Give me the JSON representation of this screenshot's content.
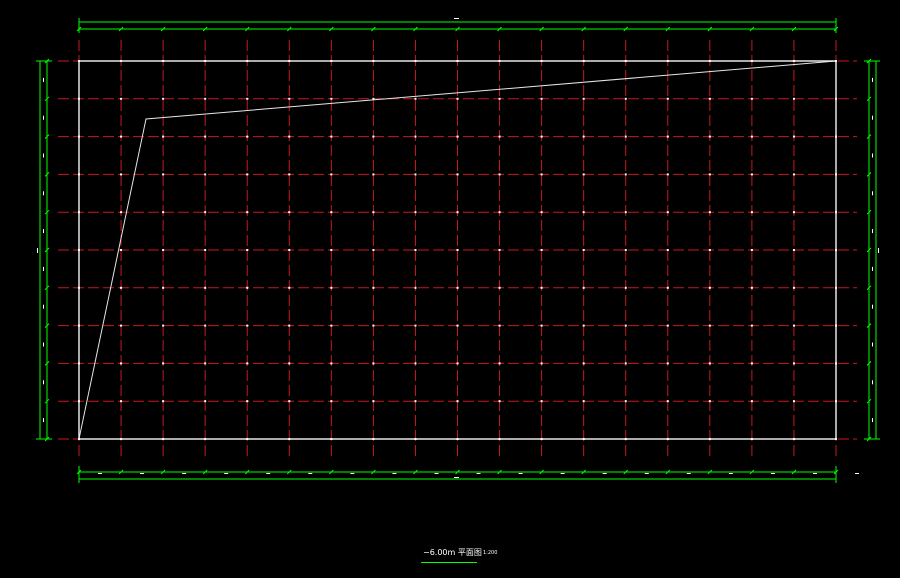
{
  "drawing": {
    "title": "−6.00m 平面图",
    "scale": "1:200"
  },
  "colors": {
    "background": "#000000",
    "axis_lines": "#c8181e",
    "outline": "#e6e6e6",
    "dimensions": "#00ff00",
    "ticks": "#ffffff"
  },
  "grid": {
    "vertical_axes": 19,
    "horizontal_axes": 11
  }
}
